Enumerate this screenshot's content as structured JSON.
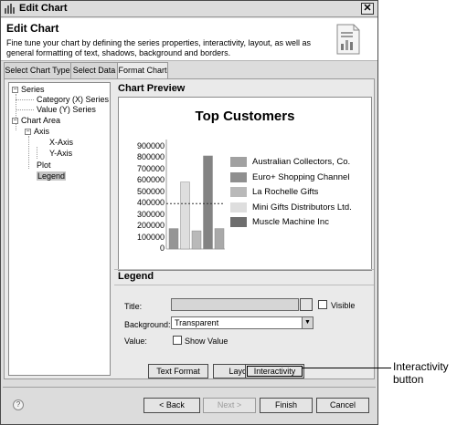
{
  "window": {
    "title": "Edit Chart",
    "close_glyph": "✕"
  },
  "header": {
    "title": "Edit Chart",
    "description": "Fine tune your chart by defining the series properties, interactivity, layout, as well as general formatting of text, shadows, background and borders.",
    "icon": "chart-document-icon"
  },
  "tabs": [
    {
      "label": "Select Chart Type"
    },
    {
      "label": "Select Data"
    },
    {
      "label": "Format Chart",
      "active": true
    }
  ],
  "tree": {
    "series": "Series",
    "category_series": "Category (X) Series",
    "value_series": "Value (Y) Series",
    "chart_area": "Chart Area",
    "axis": "Axis",
    "x_axis": "X-Axis",
    "y_axis": "Y-Axis",
    "plot": "Plot",
    "legend": "Legend",
    "selected": "Legend"
  },
  "preview": {
    "section_title": "Chart Preview"
  },
  "chart_data": {
    "type": "bar",
    "title": "Top Customers",
    "categories": [
      "Australian Collectors, Co.",
      "Euro+ Shopping Channel",
      "La Rochelle Gifts",
      "Mini Gifts Distributors Ltd.",
      "Muscle Machine Inc"
    ],
    "values": [
      180000,
      590000,
      160000,
      820000,
      180000
    ],
    "colors": [
      "#959595",
      "#dedede",
      "#b9b9b9",
      "#838383",
      "#a9a9a9"
    ],
    "legend_colors": [
      "#a1a1a1",
      "#8f8f8f",
      "#b9b9b9",
      "#dedede",
      "#6e6e6e"
    ],
    "ylim": [
      0,
      900000
    ],
    "yticks": [
      "900000",
      "800000",
      "700000",
      "600000",
      "500000",
      "400000",
      "300000",
      "200000",
      "100000",
      "0"
    ],
    "reference_line": 400000,
    "legend_position": "right"
  },
  "legend_section": {
    "section_title": "Legend",
    "title_label": "Title:",
    "title_value": "",
    "visible_label": "Visible",
    "background_label": "Background:",
    "background_value": "Transparent",
    "value_label": "Value:",
    "show_value_label": "Show Value"
  },
  "action_buttons": {
    "text_format": "Text Format",
    "layout": "Layout",
    "interactivity": "Interactivity"
  },
  "footer": {
    "help": "?",
    "back": "< Back",
    "next": "Next >",
    "finish": "Finish",
    "cancel": "Cancel"
  },
  "callout": {
    "line1": "Interactivity",
    "line2": "button"
  }
}
